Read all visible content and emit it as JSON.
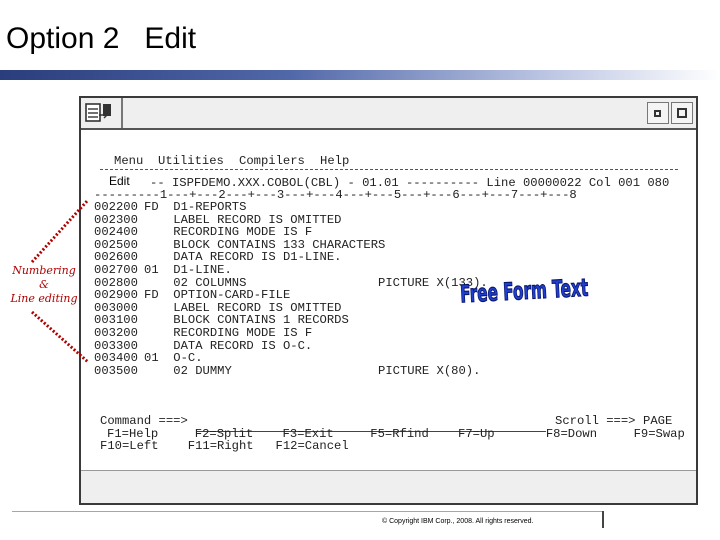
{
  "slide": {
    "title": "Option 2   Edit",
    "copyright": "© Copyright IBM Corp., 2008. All rights reserved."
  },
  "window": {
    "menu": [
      "Menu",
      "Utilities",
      "Compilers",
      "Help"
    ],
    "edit_label": "Edit",
    "header_line": "-- ISPFDEMO.XXX.COBOL(CBL) - 01.01 ---------- Line 00000022 Col 001 080",
    "ruler_line": "---------1---+---2---+---3---+---4---+---5---+---6---+---7---+---8",
    "source_lines": [
      {
        "num": "002200",
        "text": "FD  D1-REPORTS"
      },
      {
        "num": "002300",
        "text": "    LABEL RECORD IS OMITTED"
      },
      {
        "num": "002400",
        "text": "    RECORDING MODE IS F"
      },
      {
        "num": "002500",
        "text": "    BLOCK CONTAINS 133 CHARACTERS"
      },
      {
        "num": "002600",
        "text": "    DATA RECORD IS D1-LINE."
      },
      {
        "num": "002700",
        "text": "01  D1-LINE."
      },
      {
        "num": "002800",
        "text": "    02 COLUMNS                  PICTURE X(133)."
      },
      {
        "num": "002900",
        "text": "FD  OPTION-CARD-FILE"
      },
      {
        "num": "003000",
        "text": "    LABEL RECORD IS OMITTED"
      },
      {
        "num": "003100",
        "text": "    BLOCK CONTAINS 1 RECORDS"
      },
      {
        "num": "003200",
        "text": "    RECORDING MODE IS F"
      },
      {
        "num": "003300",
        "text": "    DATA RECORD IS O-C."
      },
      {
        "num": "003400",
        "text": "01  O-C."
      },
      {
        "num": "003500",
        "text": "    02 DUMMY                    PICTURE X(80)."
      }
    ],
    "command_prompt": "Command ===>",
    "scroll_label": "Scroll ===>",
    "scroll_value": "PAGE",
    "pf_row1": "F1=Help     F2=Split    F3=Exit     F5=Rfind    F7=Up       F8=Down     F9=Swap",
    "pf_row2": "F10=Left    F11=Right   F12=Cancel"
  },
  "annotations": {
    "left_line1": "Numbering",
    "left_line2": "&",
    "left_line3": "Line editing",
    "freeform": "Free Form Text"
  },
  "colors": {
    "annotation_text": "#b00000",
    "freeform_fill": "#1f3fd0",
    "title_gradient_start": "#2a3d7c"
  }
}
